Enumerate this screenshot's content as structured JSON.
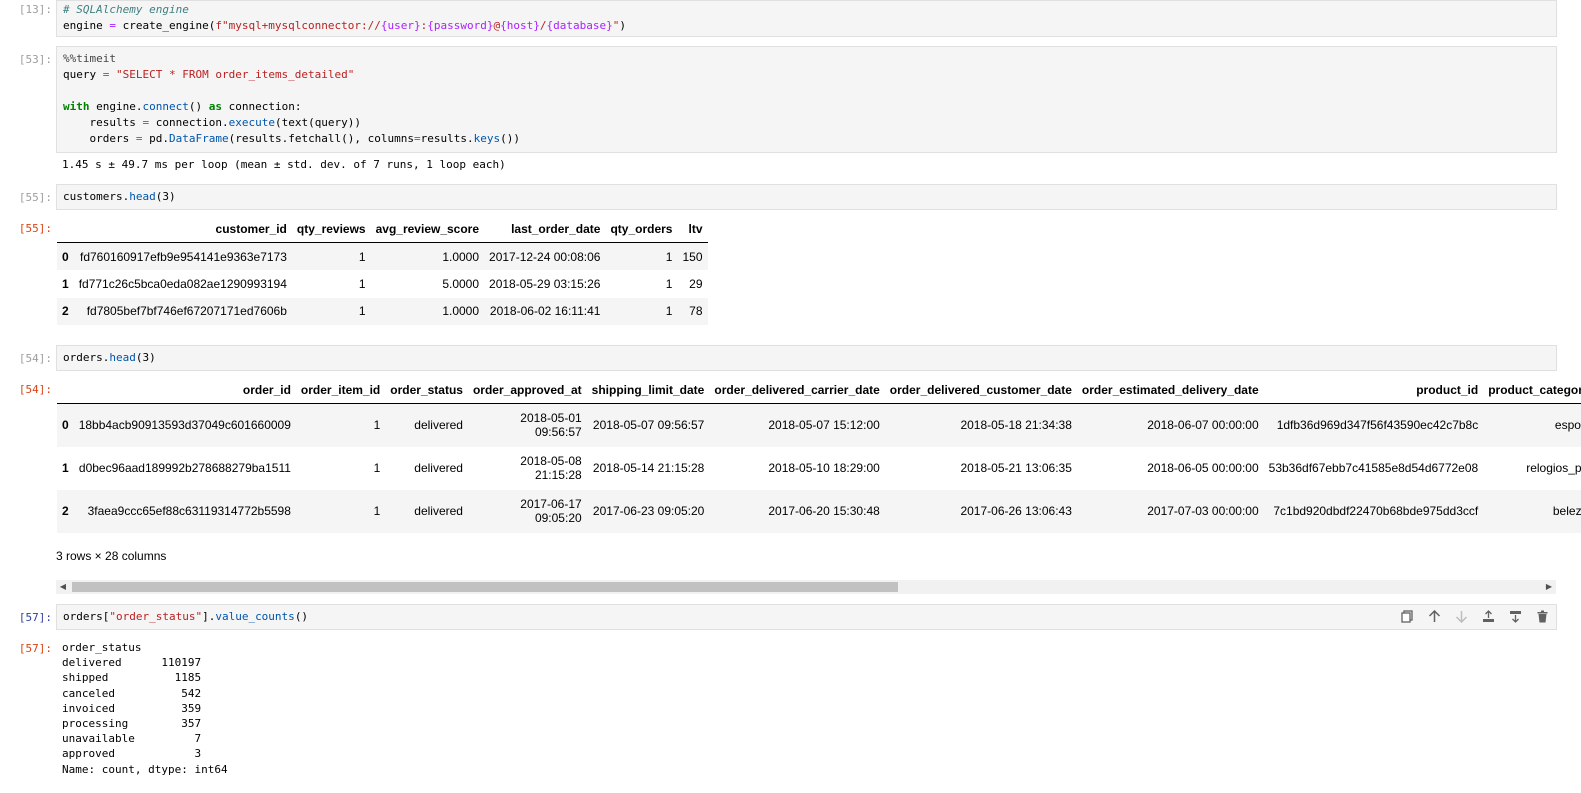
{
  "cells": {
    "c13": {
      "prompt": "[13]:",
      "line1_comment": "# SQLAlchemy engine",
      "line2_a": "engine ",
      "line2_eq": "=",
      "line2_b": " create_engine(",
      "line2_str": "f\"mysql+mysqlconnector://",
      "line2_s2": "{user}",
      "line2_s3": ":",
      "line2_s4": "{password}",
      "line2_s5": "@",
      "line2_s6": "{host}",
      "line2_s7": "/",
      "line2_s8": "{database}",
      "line2_s9": "\"",
      "line2_end": ")"
    },
    "c53": {
      "prompt_in": "[53]:",
      "l1": "%%timeit",
      "l2_a": "query ",
      "l2_eq": "=",
      "l2_str": " \"SELECT * FROM order_items_detailed\"",
      "l4_kw": "with",
      "l4_b": " engine.",
      "l4_fn": "connect",
      "l4_c": "() ",
      "l4_as": "as",
      "l4_d": " connection:",
      "l5_a": "    results ",
      "l5_eq": "=",
      "l5_b": " connection.",
      "l5_fn": "execute",
      "l5_c": "(text(query))",
      "l6_a": "    orders ",
      "l6_eq": "=",
      "l6_b": " pd.",
      "l6_fn": "DataFrame",
      "l6_c": "(results.fetchall(), columns",
      "l6_eq2": "=",
      "l6_d": "results.",
      "l6_fn2": "keys",
      "l6_e": "())",
      "stdout": "1.45 s ± 49.7 ms per loop (mean ± std. dev. of 7 runs, 1 loop each)"
    },
    "c55": {
      "prompt_in": "[55]:",
      "prompt_out": "[55]:",
      "code_a": "customers.",
      "code_fn": "head",
      "code_b": "(3)",
      "columns": [
        "",
        "customer_id",
        "qty_reviews",
        "avg_review_score",
        "last_order_date",
        "qty_orders",
        "ltv"
      ],
      "rows": [
        [
          "0",
          "fd760160917efb9e954141e9363e7173",
          "1",
          "1.0000",
          "2017-12-24 00:08:06",
          "1",
          "150"
        ],
        [
          "1",
          "fd771c26c5bca0eda082ae1290993194",
          "1",
          "5.0000",
          "2018-05-29 03:15:26",
          "1",
          "29"
        ],
        [
          "2",
          "fd7805bef7bf746ef67207171ed7606b",
          "1",
          "1.0000",
          "2018-06-02 16:11:41",
          "1",
          "78"
        ]
      ]
    },
    "c54": {
      "prompt_in": "[54]:",
      "prompt_out": "[54]:",
      "code_a": "orders.",
      "code_fn": "head",
      "code_b": "(3)",
      "columns": [
        "",
        "order_id",
        "order_item_id",
        "order_status",
        "order_approved_at",
        "shipping_limit_date",
        "order_delivered_carrier_date",
        "order_delivered_customer_date",
        "order_estimated_delivery_date",
        "product_id",
        "product_category_name"
      ],
      "rows": [
        [
          "0",
          "18bb4acb90913593d37049c601660009",
          "1",
          "delivered",
          "2018-05-01\n09:56:57",
          "2018-05-07 09:56:57",
          "2018-05-07 15:12:00",
          "2018-05-18 21:34:38",
          "2018-06-07 00:00:00",
          "1dfb36d969d347f56f43590ec42c7b8c",
          "esporte_lazer"
        ],
        [
          "1",
          "d0bec96aad189992b278688279ba1511",
          "1",
          "delivered",
          "2018-05-08\n21:15:28",
          "2018-05-14 21:15:28",
          "2018-05-10 18:29:00",
          "2018-05-21 13:06:35",
          "2018-06-05 00:00:00",
          "53b36df67ebb7c41585e8d54d6772e08",
          "relogios_presentes"
        ],
        [
          "2",
          "3faea9ccc65ef88c63119314772b5598",
          "1",
          "delivered",
          "2017-06-17\n09:05:20",
          "2017-06-23 09:05:20",
          "2017-06-20 15:30:48",
          "2017-06-26 13:06:43",
          "2017-07-03 00:00:00",
          "7c1bd920dbdf22470b68bde975dd3ccf",
          "beleza_saude"
        ]
      ],
      "shape": "3 rows × 28 columns",
      "scroll_left_icon": "triangle-left",
      "scroll_right_icon": "triangle-right"
    },
    "c57": {
      "prompt_in": "[57]:",
      "prompt_out": "[57]:",
      "code_a": "orders[",
      "code_str": "\"order_status\"",
      "code_b": "].",
      "code_fn": "value_counts",
      "code_c": "()",
      "output_lines": [
        "order_status",
        "delivered      110197",
        "shipped          1185",
        "canceled          542",
        "invoiced          359",
        "processing        357",
        "unavailable         7",
        "approved            3",
        "Name: count, dtype: int64"
      ]
    }
  },
  "toolbar": {
    "icons": [
      "duplicate-icon",
      "move-up-icon",
      "move-down-icon",
      "insert-above-icon",
      "insert-below-icon",
      "delete-icon"
    ]
  },
  "colors": {
    "prompt_in": "#303f9f",
    "prompt_out": "#d84315",
    "cell_bg": "#f5f5f5"
  }
}
